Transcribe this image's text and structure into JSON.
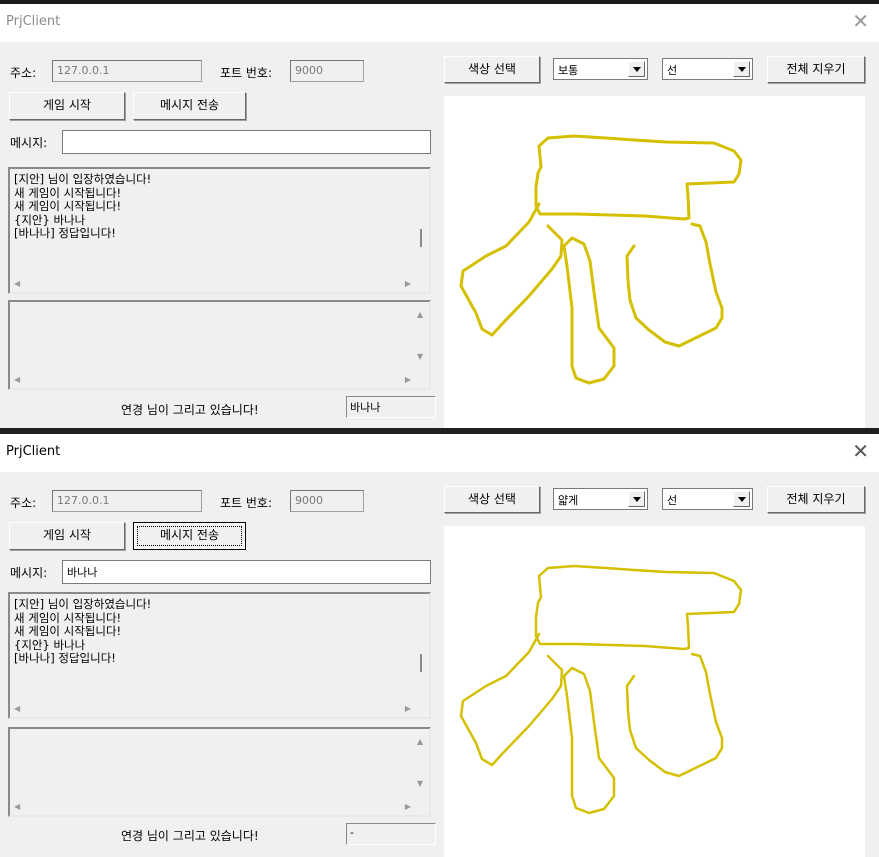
{
  "windows": [
    {
      "title": "PrjClient",
      "address_label": "주소:",
      "address_value": "127.0.0.1",
      "port_label": "포트 번호:",
      "port_value": "9000",
      "color_button": "색상 선택",
      "thickness_value": "보통",
      "shape_value": "선",
      "clear_button": "전체 지우기",
      "start_button": "게임 시작",
      "send_button": "메시지 전송",
      "message_label": "메시지:",
      "message_value": "",
      "chat_lines": [
        "[지안] 님이 입장하였습니다!",
        "새 게임이 시작됩니다!",
        "새 게임이 시작됩니다!",
        "{지안} 바나나",
        "[바나나] 정답입니다!"
      ],
      "drawer_status": "연경  님이 그리고 있습니다!",
      "answer_value": "바나나"
    },
    {
      "title": "PrjClient",
      "address_label": "주소:",
      "address_value": "127.0.0.1",
      "port_label": "포트 번호:",
      "port_value": "9000",
      "color_button": "색상 선택",
      "thickness_value": "얇게",
      "shape_value": "선",
      "clear_button": "전체 지우기",
      "start_button": "게임 시작",
      "send_button": "메시지 전송",
      "message_label": "메시지:",
      "message_value": "바나나",
      "chat_lines": [
        "[지안] 님이 입장하였습니다!",
        "새 게임이 시작됩니다!",
        "새 게임이 시작됩니다!",
        "{지안} 바나나",
        "[바나나] 정답입니다!"
      ],
      "drawer_status": "연경  님이 그리고 있습니다!",
      "answer_value": "-"
    }
  ],
  "drawing": {
    "stroke_color": "#d4c000"
  },
  "icons": {
    "close": "close-icon",
    "dropdown": "chevron-down-icon"
  }
}
